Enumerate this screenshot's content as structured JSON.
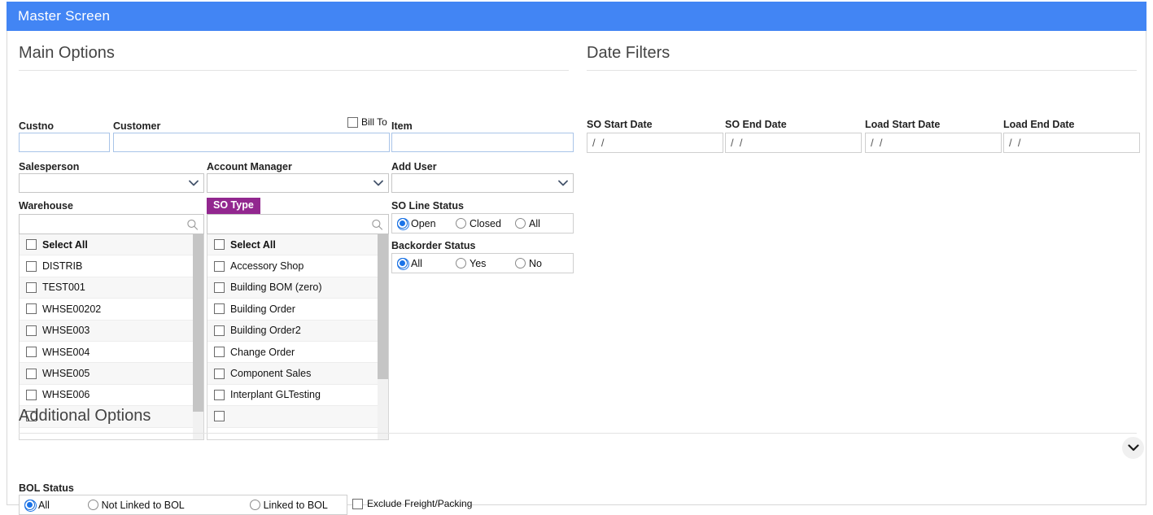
{
  "window": {
    "title": "Master Screen"
  },
  "sections": {
    "main": "Main Options",
    "dates": "Date Filters",
    "additional": "Additional Options"
  },
  "main": {
    "custno": {
      "label": "Custno",
      "value": "",
      "placeholder": ""
    },
    "customer": {
      "label": "Customer",
      "value": "",
      "placeholder": ""
    },
    "bill_to": {
      "label": "Bill To",
      "checked": false
    },
    "item": {
      "label": "Item",
      "value": "",
      "placeholder": ""
    },
    "salesperson": {
      "label": "Salesperson",
      "value": ""
    },
    "account_manager": {
      "label": "Account Manager",
      "value": ""
    },
    "add_user": {
      "label": "Add User",
      "value": ""
    },
    "warehouse": {
      "label": "Warehouse",
      "search_value": "",
      "items": [
        "Select All",
        "DISTRIB",
        "TEST001",
        "WHSE00202",
        "WHSE003",
        "WHSE004",
        "WHSE005",
        "WHSE006",
        ""
      ]
    },
    "so_type": {
      "label": "SO Type",
      "search_value": "",
      "items": [
        "Select All",
        "Accessory Shop",
        "Building BOM (zero)",
        "Building Order",
        "Building Order2",
        "Change Order",
        "Component Sales",
        "Interplant GLTesting",
        ""
      ]
    },
    "so_line_status": {
      "label": "SO Line Status",
      "options": [
        "Open",
        "Closed",
        "All"
      ],
      "selected": "Open"
    },
    "backorder_status": {
      "label": "Backorder Status",
      "options": [
        "All",
        "Yes",
        "No"
      ],
      "selected": "All"
    }
  },
  "dates": {
    "so_start": {
      "label": "SO Start Date",
      "value": "/  /"
    },
    "so_end": {
      "label": "SO End Date",
      "value": "/  /"
    },
    "load_start": {
      "label": "Load Start Date",
      "value": "/  /"
    },
    "load_end": {
      "label": "Load End Date",
      "value": "/  /"
    }
  },
  "additional": {
    "bol_status": {
      "label": "BOL Status",
      "options": [
        "All",
        "Not Linked to BOL",
        "Linked to BOL"
      ],
      "selected": "All"
    },
    "exclude_freight": {
      "label": "Exclude Freight/Packing",
      "checked": false
    }
  },
  "icons": {
    "search": "search-icon",
    "calendar": "calendar-icon",
    "chevron_down": "chevron-down-icon",
    "collapse": "collapse-section-icon"
  },
  "colors": {
    "titlebar": "#4285f4",
    "badge": "#92278f",
    "radio_selected": "#1a73e8",
    "input_border": "#a9c4e8"
  }
}
